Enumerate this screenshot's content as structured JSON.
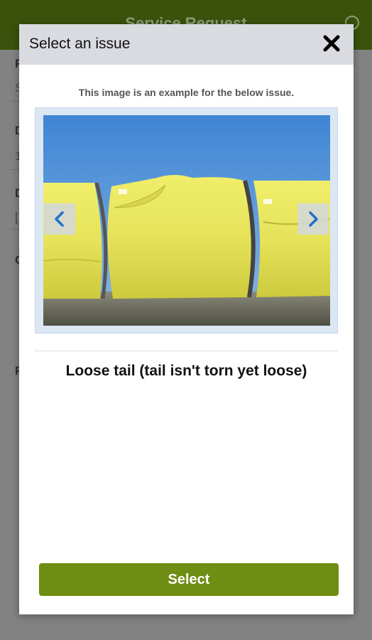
{
  "app": {
    "title": "Service Request",
    "bg_field_letters": [
      "F",
      "D",
      "D",
      "C",
      "F"
    ],
    "bg_field_values": [
      "S",
      "1",
      "["
    ]
  },
  "modal": {
    "title": "Select an issue",
    "close_icon": "close-icon",
    "caption": "This image is an example for the below issue.",
    "image_alt": "Yellow wrapped cotton module bales with loose tail",
    "prev_icon": "chevron-left-icon",
    "next_icon": "chevron-right-icon",
    "issue_label": "Loose tail (tail isn't torn yet loose)",
    "select_label": "Select"
  },
  "colors": {
    "header_bg": "#3a520b",
    "modal_header_bg": "#d9dbe0",
    "select_button": "#6e8d12",
    "arrow_blue": "#1f6fd0"
  }
}
